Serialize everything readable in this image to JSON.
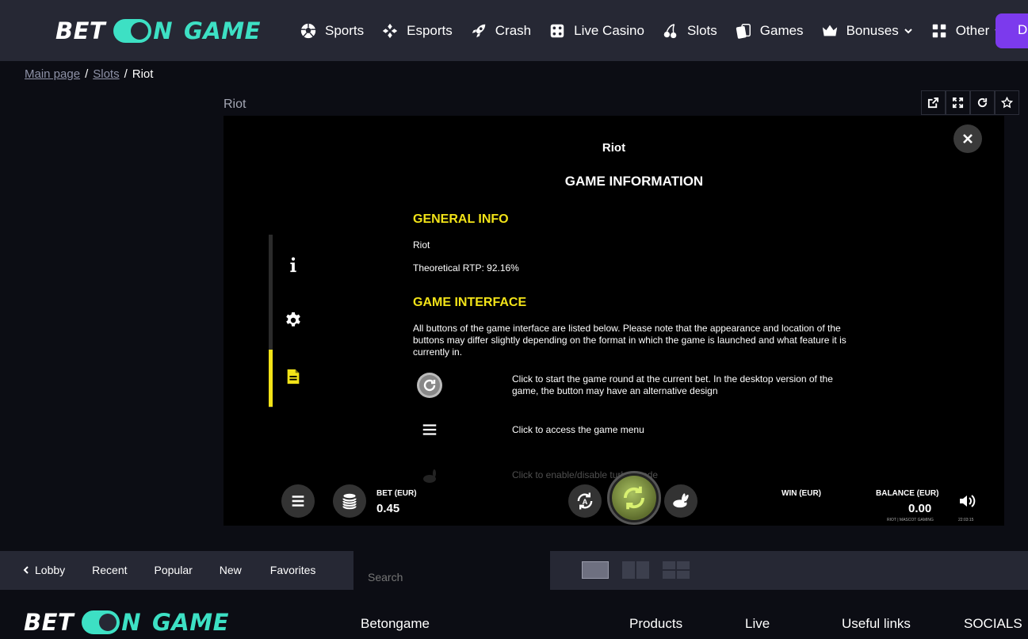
{
  "header": {
    "logo": {
      "part1": "BET",
      "part2": "N",
      "part3": "GAME"
    },
    "nav": [
      {
        "label": "Sports",
        "icon": "soccer-ball-icon"
      },
      {
        "label": "Esports",
        "icon": "gamepad-icon"
      },
      {
        "label": "Crash",
        "icon": "rocket-icon"
      },
      {
        "label": "Live Casino",
        "icon": "dice-icon"
      },
      {
        "label": "Slots",
        "icon": "cherries-icon"
      },
      {
        "label": "Games",
        "icon": "cards-icon"
      },
      {
        "label": "Bonuses",
        "icon": "crown-icon"
      },
      {
        "label": "Other",
        "icon": "grid-icon"
      }
    ],
    "deposit_label": "De"
  },
  "breadcrumb": {
    "home": "Main page",
    "slots": "Slots",
    "current": "Riot"
  },
  "game": {
    "title": "Riot",
    "info_title": "Riot",
    "info_heading": "GAME INFORMATION",
    "general_info_heading": "GENERAL INFO",
    "game_name": "Riot",
    "rtp": "Theoretical RTP: 92.16%",
    "interface_heading": "GAME INTERFACE",
    "interface_text": "All buttons of the game interface are listed below. Please note that the appearance and location of the buttons may differ slightly depending on the format in which the game is launched and what feature it is currently in.",
    "rows": [
      {
        "text": "Click to start the game round at the current bet. In the desktop version of the game, the button may have an alternative design"
      },
      {
        "text": "Click to access the game menu"
      },
      {
        "text": "Click to enable/disable turbo mode"
      }
    ],
    "bet_label": "BET (EUR)",
    "bet_value": "0.45",
    "win_label": "WIN (EUR)",
    "balance_label": "BALANCE (EUR)",
    "balance_value": "0.00",
    "provider_tag": "RIOT | MASCOT GAMING",
    "clock": "22:03:15"
  },
  "lobby": {
    "tabs": [
      "Lobby",
      "Recent",
      "Popular",
      "New",
      "Favorites"
    ],
    "search_placeholder": "Search"
  },
  "footer": {
    "columns": [
      "Betongame",
      "Products",
      "Live",
      "Useful links",
      "SOCIALS"
    ]
  },
  "colors": {
    "accent": "#3de0c4",
    "yellow": "#f2e318",
    "purple": "#7c3aed",
    "header_bg": "#262834"
  }
}
